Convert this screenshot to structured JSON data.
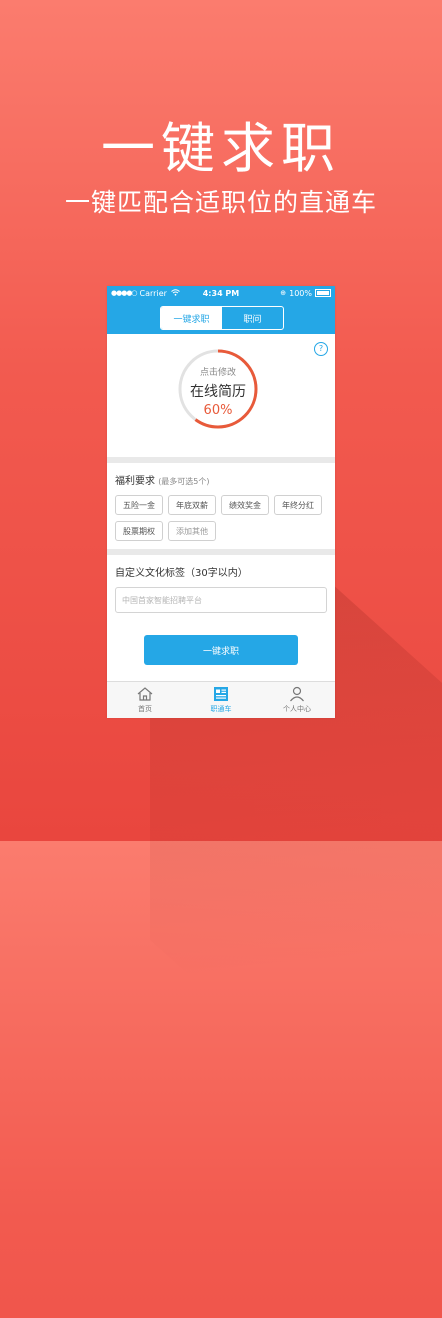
{
  "hero": {
    "title": "一键求职",
    "subtitle": "一键匹配合适职位的直通车"
  },
  "status_bar": {
    "carrier": "Carrier",
    "time": "4:34 PM",
    "battery": "100%"
  },
  "segmented": {
    "tabs": [
      {
        "label": "一键求职",
        "active": true
      },
      {
        "label": "职问",
        "active": false
      }
    ]
  },
  "resume": {
    "help_label": "?",
    "tap_hint": "点击修改",
    "title": "在线简历",
    "progress_label": "60%",
    "progress": 0.6
  },
  "benefits": {
    "title": "福利要求",
    "hint": "(最多可选5个)",
    "tags": [
      "五险一金",
      "年底双薪",
      "绩效奖金",
      "年终分红",
      "股票期权"
    ],
    "add_label": "添加其他"
  },
  "culture": {
    "title": "自定义文化标签（30字以内）",
    "placeholder": "中国首家智能招聘平台"
  },
  "submit": {
    "label": "一键求职"
  },
  "tabbar": {
    "items": [
      {
        "label": "首页",
        "icon": "home-icon",
        "active": false
      },
      {
        "label": "职通车",
        "icon": "job-express-icon",
        "active": true
      },
      {
        "label": "个人中心",
        "icon": "profile-icon",
        "active": false
      }
    ]
  },
  "colors": {
    "accent": "#25a7e6",
    "progress": "#e85a3a",
    "background_top": "#fb7c6e",
    "background_bottom": "#e9463e"
  }
}
